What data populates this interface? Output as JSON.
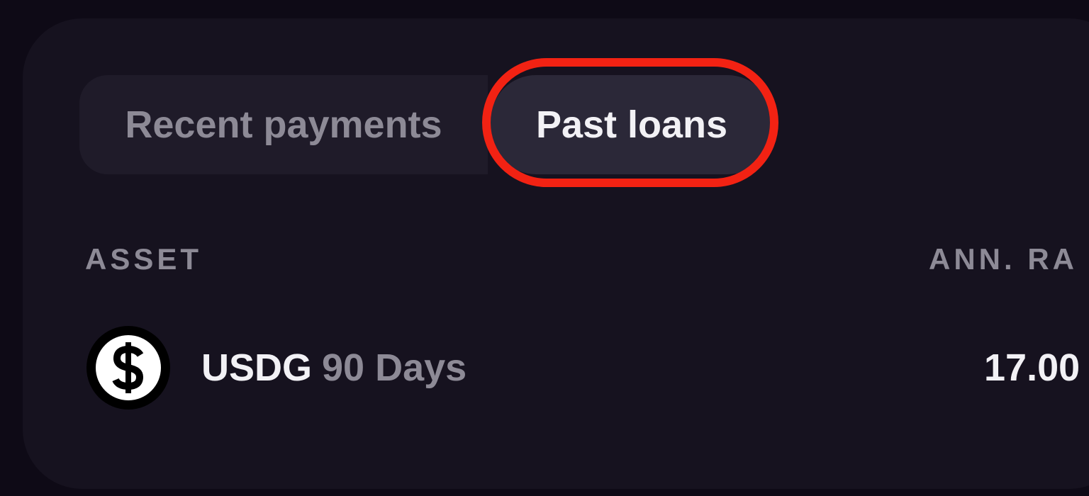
{
  "tabs": {
    "recent_label": "Recent payments",
    "past_label": "Past loans"
  },
  "table": {
    "headers": {
      "asset": "ASSET",
      "rate": "ANN. RA"
    },
    "rows": [
      {
        "icon": "dollar-coin-icon",
        "asset": "USDG",
        "term": "90 Days",
        "rate": "17.00"
      }
    ]
  },
  "colors": {
    "background": "#0e0a16",
    "panel": "#16121f",
    "tab_active": "#2b2838",
    "tab_inactive": "#1f1b29",
    "text_primary": "#f2f1f5",
    "text_muted": "#8d8a96",
    "highlight": "#f22213"
  }
}
